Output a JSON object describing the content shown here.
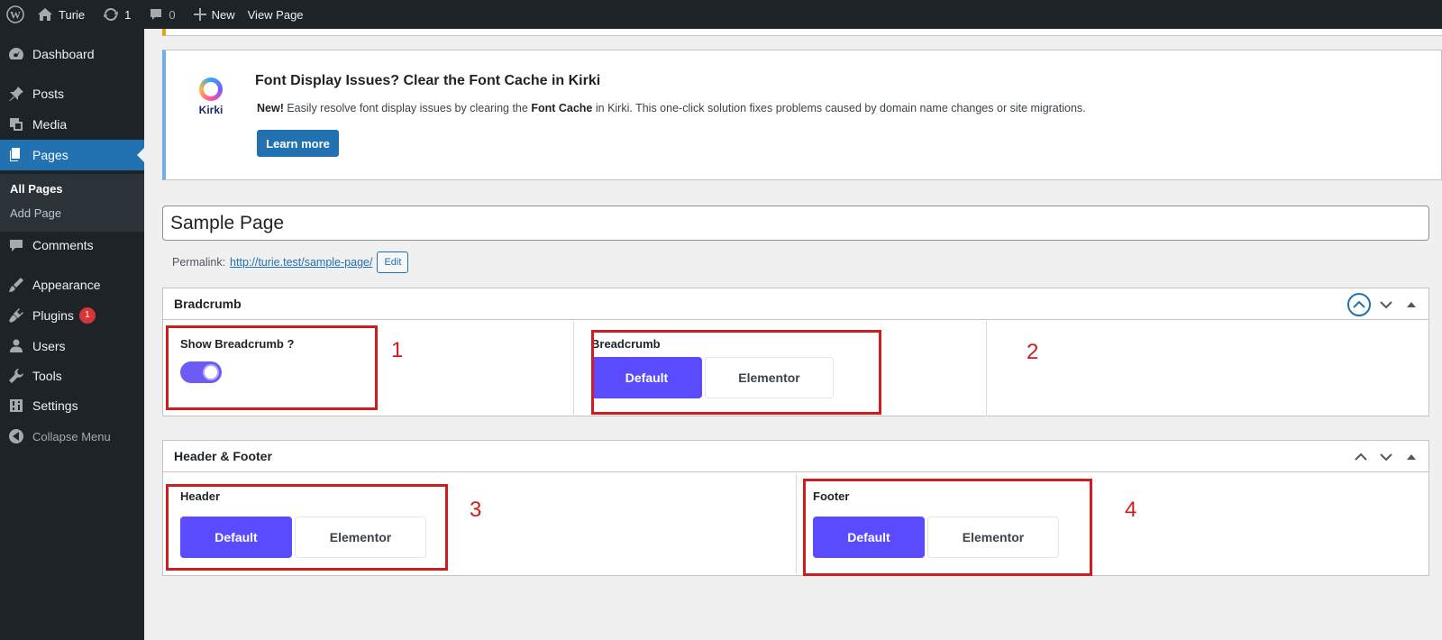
{
  "adminbar": {
    "site_name": "Turie",
    "updates_count": "1",
    "comments_count": "0",
    "new_label": "New",
    "view_page_label": "View Page"
  },
  "sidebar": {
    "items": [
      {
        "label": "Dashboard",
        "icon": "dashboard-icon"
      },
      {
        "label": "Posts",
        "icon": "pin-icon"
      },
      {
        "label": "Media",
        "icon": "media-icon"
      },
      {
        "label": "Pages",
        "icon": "pages-icon"
      },
      {
        "label": "Comments",
        "icon": "comment-icon"
      },
      {
        "label": "Appearance",
        "icon": "brush-icon"
      },
      {
        "label": "Plugins",
        "icon": "plugin-icon"
      },
      {
        "label": "Users",
        "icon": "users-icon"
      },
      {
        "label": "Tools",
        "icon": "wrench-icon"
      },
      {
        "label": "Settings",
        "icon": "settings-icon"
      }
    ],
    "plugins_badge": "1",
    "submenu": [
      "All Pages",
      "Add Page"
    ],
    "collapse_label": "Collapse Menu"
  },
  "notice": {
    "logo_text": "Kirki",
    "title": "Font Display Issues? Clear the Font Cache in Kirki",
    "text_new": "New!",
    "text_part1": " Easily resolve font display issues by clearing the ",
    "text_bold": "Font Cache",
    "text_part2": " in Kirki. This one-click solution fixes problems caused by domain name changes or site migrations.",
    "button_label": "Learn more"
  },
  "editor": {
    "title_value": "Sample Page",
    "permalink_label": "Permalink:",
    "permalink_url": "http://turie.test/sample-page/",
    "edit_label": "Edit"
  },
  "breadcrumb_box": {
    "title": "Bradcrumb",
    "show_label": "Show Breadcrumb ?",
    "toggle_on": true,
    "select_label": "Breadcrumb",
    "options": [
      "Default",
      "Elementor"
    ],
    "selected": "Default"
  },
  "header_footer_box": {
    "title": "Header & Footer",
    "header_label": "Header",
    "footer_label": "Footer",
    "header_options": [
      "Default",
      "Elementor"
    ],
    "footer_options": [
      "Default",
      "Elementor"
    ],
    "selected": "Default"
  },
  "annotations": [
    "1",
    "2",
    "3",
    "4"
  ],
  "colors": {
    "admin_dark": "#1d2327",
    "wp_blue": "#2271b1",
    "accent_purple": "#5b4bff",
    "annotation_red": "#d01c1f"
  }
}
